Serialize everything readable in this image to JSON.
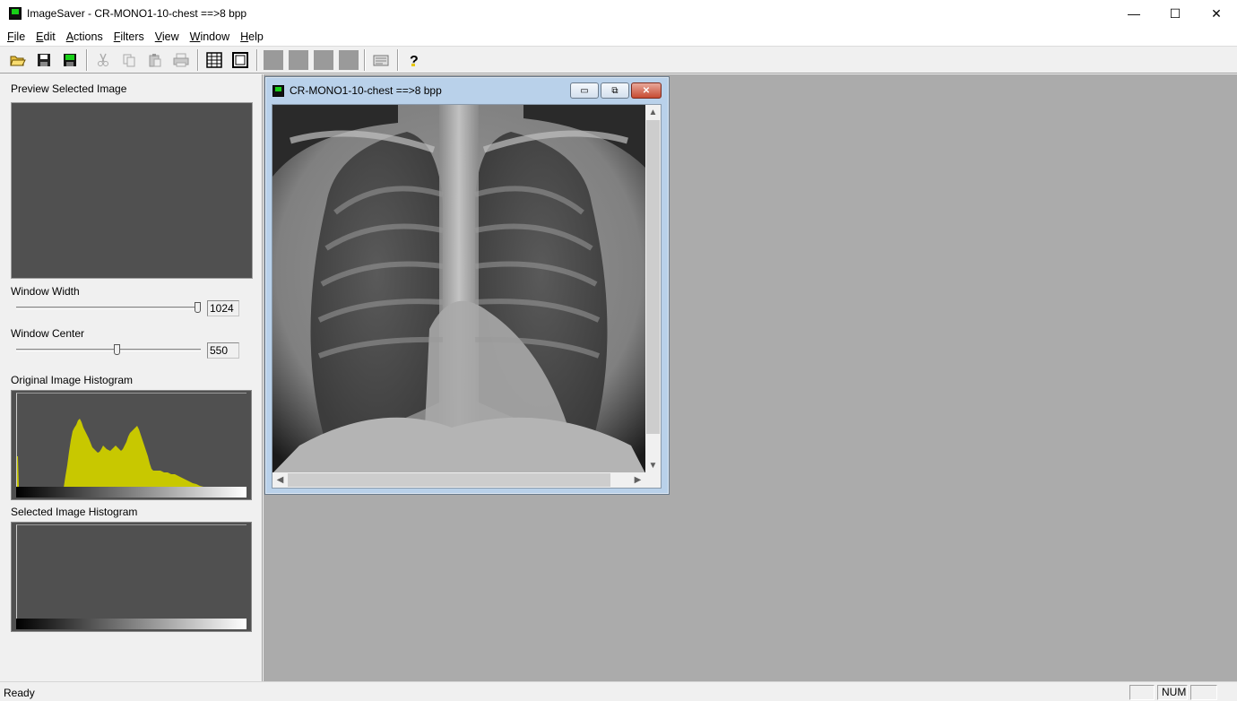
{
  "app": {
    "title": "ImageSaver - CR-MONO1-10-chest ==>8 bpp",
    "window_controls": {
      "minimize": "—",
      "maximize": "☐",
      "close": "✕"
    }
  },
  "menu": [
    {
      "label": "File",
      "u": "F",
      "rest": "ile"
    },
    {
      "label": "Edit",
      "u": "E",
      "rest": "dit"
    },
    {
      "label": "Actions",
      "u": "A",
      "rest": "ctions"
    },
    {
      "label": "Filters",
      "u": "F",
      "rest": "ilters"
    },
    {
      "label": "View",
      "u": "V",
      "rest": "iew"
    },
    {
      "label": "Window",
      "u": "W",
      "rest": "indow"
    },
    {
      "label": "Help",
      "u": "H",
      "rest": "elp"
    }
  ],
  "toolbar": {
    "icons": [
      "open-folder-icon",
      "save-icon",
      "save-as-icon",
      "cut-icon",
      "copy-icon",
      "paste-icon",
      "print-icon",
      "grid-icon",
      "frame-icon",
      "help-icon"
    ]
  },
  "left_panel": {
    "preview_label": "Preview Selected Image",
    "window_width_label": "Window Width",
    "window_width_value": "1024",
    "window_width_level": 1.0,
    "window_center_label": "Window Center",
    "window_center_value": "550",
    "window_center_level": 0.55,
    "original_hist_label": "Original Image Histogram",
    "selected_hist_label": "Selected Image Histogram",
    "histogram_color": "#c8c800"
  },
  "child_window": {
    "title": "CR-MONO1-10-chest ==>8 bpp",
    "minimize": "▭",
    "restore": "⧉",
    "close": "✕"
  },
  "status": {
    "text": "Ready",
    "num": "NUM"
  }
}
